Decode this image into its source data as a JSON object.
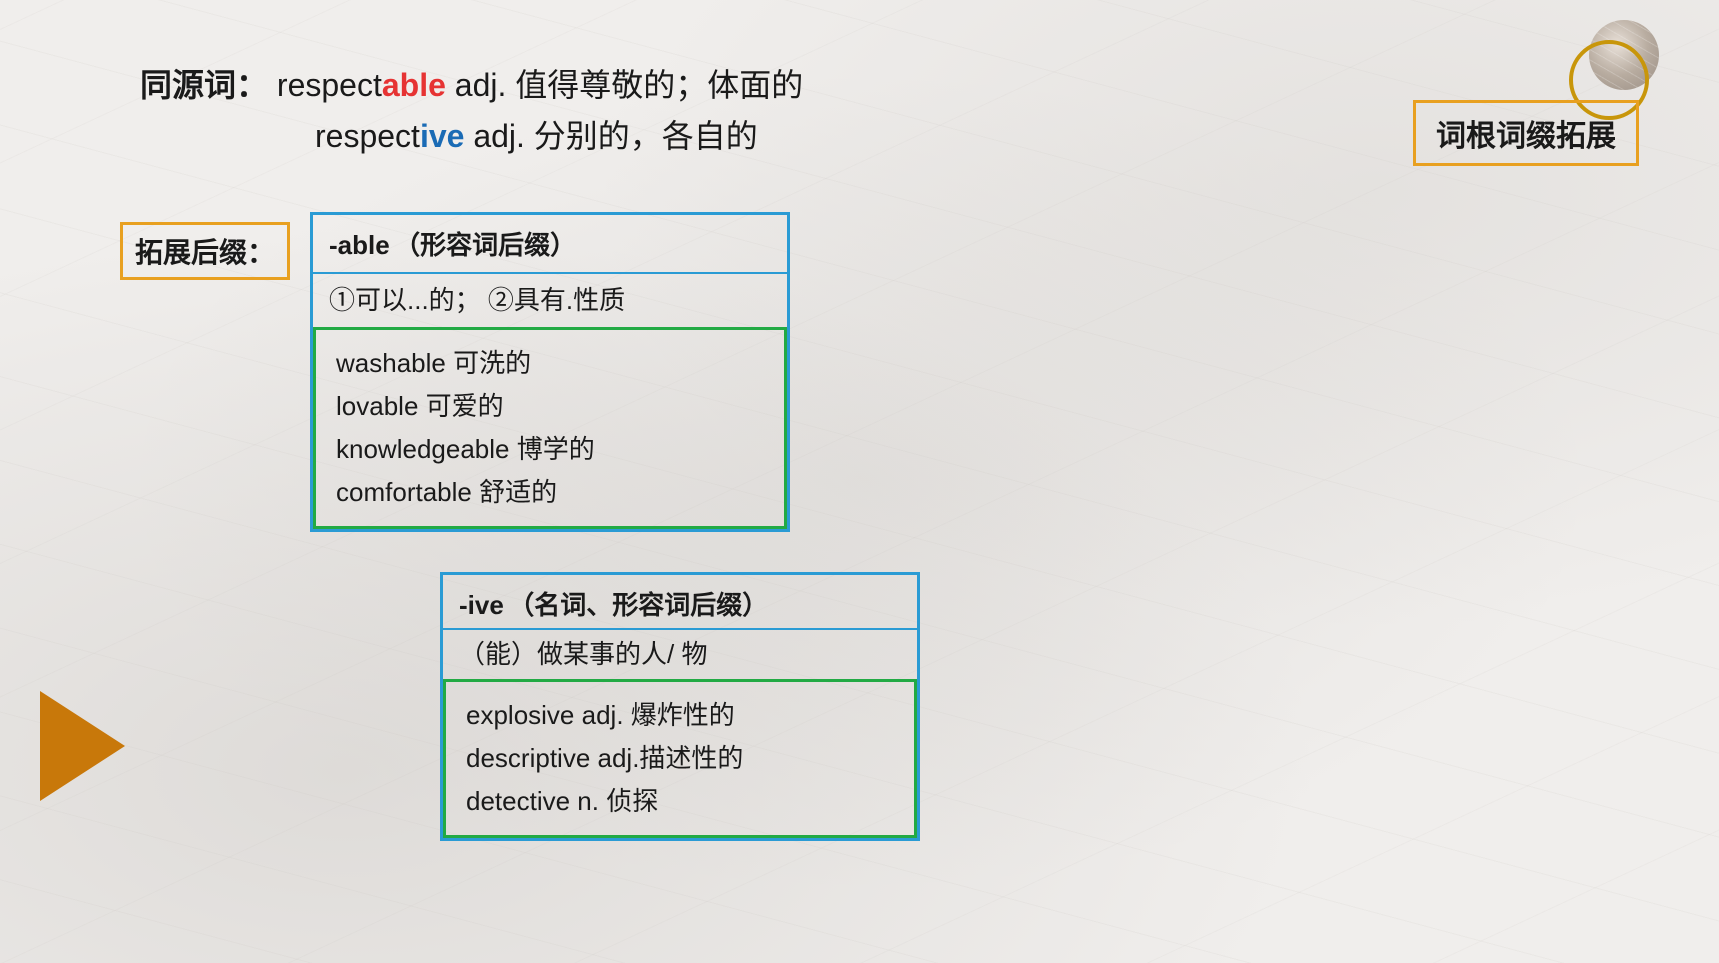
{
  "page": {
    "title": "词根词缀拓展",
    "background_color": "#f0eeec"
  },
  "synonyms_section": {
    "label": "同源词：",
    "word1": {
      "prefix": "respect",
      "highlight": "able",
      "highlight_color": "red",
      "pos": "adj.",
      "meaning": "值得尊敬的；体面的"
    },
    "word2": {
      "prefix": "respect",
      "highlight": "ive",
      "highlight_color": "blue",
      "pos": "adj.",
      "meaning": "分别的，各自的"
    }
  },
  "top_right": {
    "label": "词根词缀拓展"
  },
  "able_section": {
    "label": "拓展后缀：",
    "suffix": "-able",
    "description": "（形容词后缀）",
    "meaning1": "①可以...的；",
    "meaning2": "②具有.性质",
    "words": [
      {
        "word": "washable",
        "meaning": "可洗的"
      },
      {
        "word": "lovable",
        "meaning": "可爱的"
      },
      {
        "word": "knowledgeable",
        "meaning": "博学的"
      },
      {
        "word": "comfortable",
        "meaning": "舒适的"
      }
    ]
  },
  "ive_section": {
    "suffix": "-ive",
    "description": "（名词、形容词后缀）",
    "meaning": "（能）做某事的人/ 物",
    "words": [
      {
        "word": "explosive",
        "pos": "adj.",
        "meaning": "爆炸性的"
      },
      {
        "word": "descriptive",
        "pos": "adj.",
        "meaning": "描述性的"
      },
      {
        "word": "detective",
        "pos": "n.",
        "meaning": "侦探"
      }
    ]
  }
}
